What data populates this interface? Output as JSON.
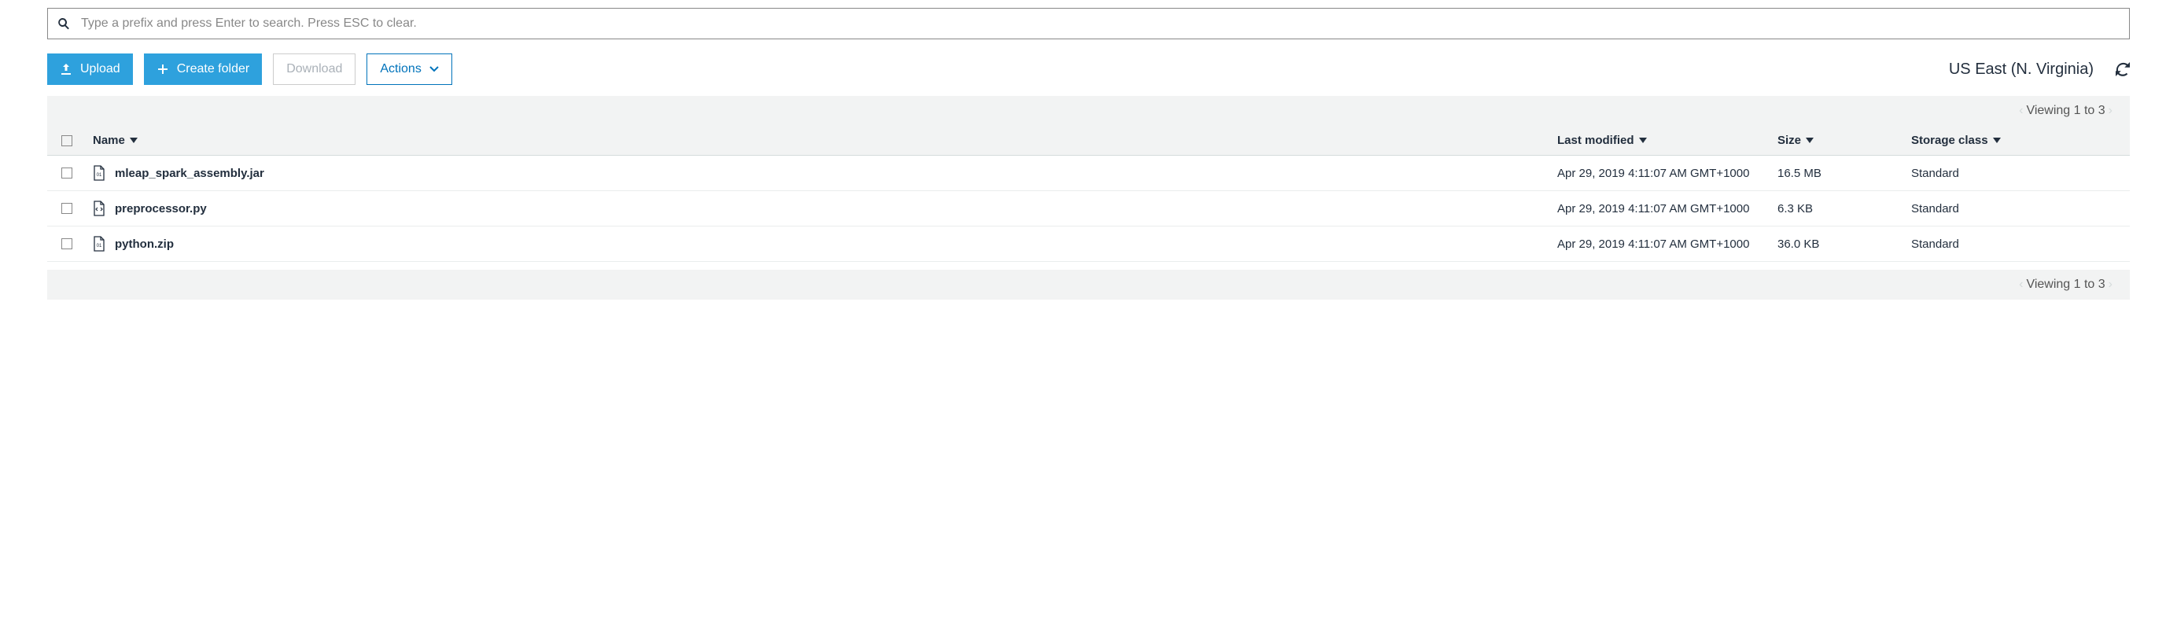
{
  "search": {
    "placeholder": "Type a prefix and press Enter to search. Press ESC to clear."
  },
  "toolbar": {
    "upload_label": "Upload",
    "create_folder_label": "Create folder",
    "download_label": "Download",
    "actions_label": "Actions",
    "region_label": "US East (N. Virginia)"
  },
  "paging": {
    "label": "Viewing 1 to 3"
  },
  "columns": {
    "name": "Name",
    "last_modified": "Last modified",
    "size": "Size",
    "storage_class": "Storage class"
  },
  "rows": [
    {
      "name": "mleap_spark_assembly.jar",
      "modified": "Apr 29, 2019 4:11:07 AM GMT+1000",
      "size": "16.5 MB",
      "storage": "Standard",
      "icon": "binary"
    },
    {
      "name": "preprocessor.py",
      "modified": "Apr 29, 2019 4:11:07 AM GMT+1000",
      "size": "6.3 KB",
      "storage": "Standard",
      "icon": "code"
    },
    {
      "name": "python.zip",
      "modified": "Apr 29, 2019 4:11:07 AM GMT+1000",
      "size": "36.0 KB",
      "storage": "Standard",
      "icon": "binary"
    }
  ]
}
